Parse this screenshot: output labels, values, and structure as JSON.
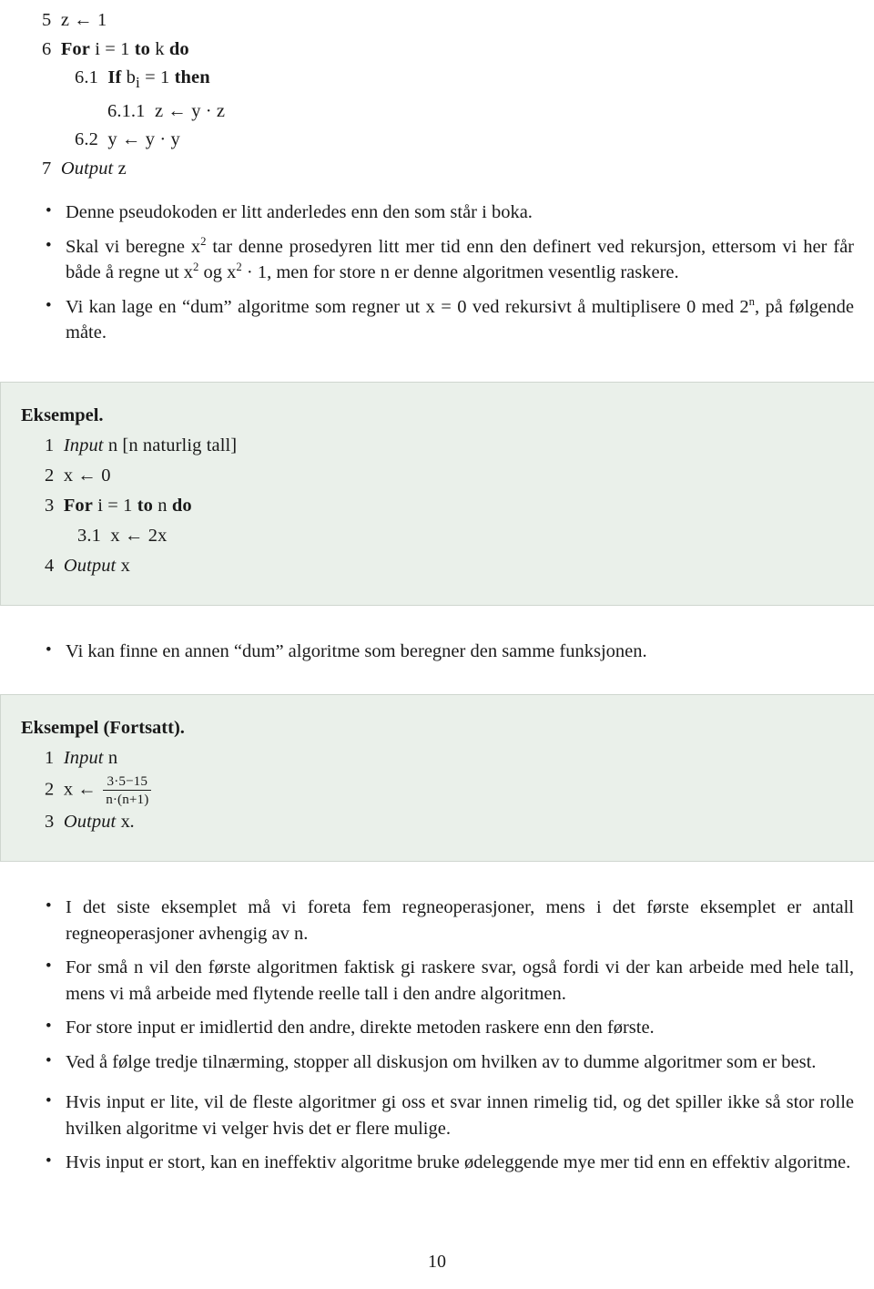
{
  "document": {
    "page_number": "10",
    "language": "Norwegian",
    "accent_box_color": "#eaf0ea",
    "accent_box_border": "#cfd6cf",
    "text_color": "#1a1a1a"
  },
  "top_pseudocode": {
    "lines": [
      {
        "num": "5",
        "indent": 0,
        "parts": [
          {
            "t": "z ",
            "s": "mv"
          },
          {
            "t": "← 1",
            "s": "mv"
          }
        ]
      },
      {
        "num": "6",
        "indent": 0,
        "parts": [
          {
            "t": "For ",
            "s": "kw"
          },
          {
            "t": "i ",
            "s": "mv"
          },
          {
            "t": "= 1 ",
            "s": "mv"
          },
          {
            "t": "to ",
            "s": "kw"
          },
          {
            "t": "k ",
            "s": "mv"
          },
          {
            "t": "do",
            "s": "kw"
          }
        ]
      },
      {
        "num": "6.1",
        "indent": 1,
        "parts": [
          {
            "t": "If ",
            "s": "kw"
          },
          {
            "t": "b",
            "s": "mv"
          },
          {
            "t": "i",
            "s": "sub"
          },
          {
            "t": " = 1 ",
            "s": "mv"
          },
          {
            "t": "then",
            "s": "kw"
          }
        ]
      },
      {
        "num": "6.1.1",
        "indent": 2,
        "parts": [
          {
            "t": "z ← y · z",
            "s": "mv"
          }
        ]
      },
      {
        "num": "6.2",
        "indent": 1,
        "parts": [
          {
            "t": "y ← y · y",
            "s": "mv"
          }
        ]
      },
      {
        "num": "7",
        "indent": 0,
        "parts": [
          {
            "t": "Output ",
            "s": "it"
          },
          {
            "t": "z",
            "s": "mv"
          }
        ]
      }
    ],
    "line_texts": [
      "5  z ← 1",
      "6  For i = 1 to k do",
      "6.1  If bᵢ = 1 then",
      "6.1.1  z ← y · z",
      "6.2  y ← y · y",
      "7  Output z"
    ]
  },
  "bullets_top": [
    {
      "text": "Denne pseudokoden er litt anderledes enn den som står i boka."
    },
    {
      "text": "Skal vi beregne x² tar denne prosedyren litt mer tid enn den definert ved rekursjon, ettersom vi her får både å regne ut x² og x² · 1, men for store n er denne algoritmen vesentlig raskere."
    },
    {
      "text": "Vi kan lage en “dum” algoritme som regner ut x = 0 ved rekursivt å multiplisere 0 med 2ⁿ, på følgende måte."
    }
  ],
  "example_1": {
    "title": "Eksempel.",
    "lines": [
      {
        "num": "1",
        "indent": 0,
        "text": "Input n [n naturlig tall]"
      },
      {
        "num": "2",
        "indent": 0,
        "text": "x ← 0"
      },
      {
        "num": "3",
        "indent": 0,
        "text": "For i = 1 to n do"
      },
      {
        "num": "3.1",
        "indent": 1,
        "text": "x ← 2x"
      },
      {
        "num": "4",
        "indent": 0,
        "text": "Output x"
      }
    ]
  },
  "bullet_middle": {
    "text": "Vi kan finne en annen “dum” algoritme som beregner den samme funksjonen."
  },
  "example_2": {
    "title": "Eksempel (Fortsatt).",
    "lines": [
      {
        "num": "1",
        "indent": 0,
        "text": "Input n"
      },
      {
        "num": "2",
        "indent": 0,
        "text": "x ← (3·5−15) / (n·(n+1))",
        "fraction": {
          "numerator": "3·5−15",
          "denominator": "n·(n+1)"
        }
      },
      {
        "num": "3",
        "indent": 0,
        "text": "Output x."
      }
    ]
  },
  "bullets_bottom": [
    {
      "text": "I det siste eksemplet må vi foreta fem regneoperasjoner, mens i det første eksemplet er antall regneoperasjoner avhengig av n."
    },
    {
      "text": "For små n vil den første algoritmen faktisk gi raskere svar, også fordi vi der kan arbeide med hele tall, mens vi må arbeide med flytende reelle tall i den andre algoritmen."
    },
    {
      "text": "For store input er imidlertid den andre, direkte metoden raskere enn den første."
    },
    {
      "text": "Ved å følge tredje tilnærming, stopper all diskusjon om hvilken av to dumme algoritmer som er best."
    },
    {
      "text": "Hvis input er lite, vil de fleste algoritmer gi oss et svar innen rimelig tid, og det spiller ikke så stor rolle hvilken algoritme vi velger hvis det er flere mulige."
    },
    {
      "text": "Hvis input er stort, kan en ineffektiv algoritme bruke ødeleggende mye mer tid enn en effektiv algoritme."
    }
  ]
}
